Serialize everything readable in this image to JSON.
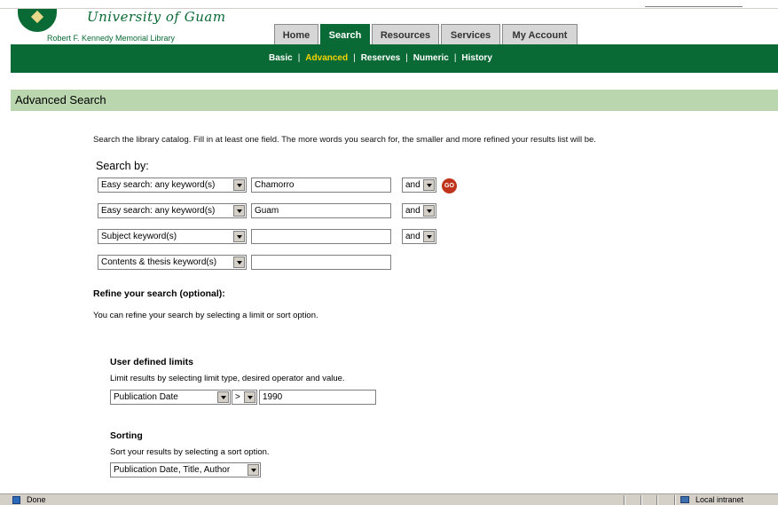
{
  "header": {
    "university": "University of Guam",
    "library": "Robert F. Kennedy Memorial Library",
    "tabs": [
      "Home",
      "Search",
      "Resources",
      "Services",
      "My Account"
    ],
    "active_tab": "Search",
    "subnav": [
      "Basic",
      "Advanced",
      "Reserves",
      "Numeric",
      "History"
    ],
    "active_subnav": "Advanced"
  },
  "page": {
    "title": "Advanced Search",
    "intro": "Search the library catalog. Fill in at least one field. The more words you search for, the smaller and more refined your results list will be.",
    "search_by_label": "Search by:"
  },
  "search_rows": [
    {
      "field": "Easy search: any keyword(s)",
      "value": "Chamorro",
      "operator": "and"
    },
    {
      "field": "Easy search: any keyword(s)",
      "value": "Guam",
      "operator": "and"
    },
    {
      "field": "Subject keyword(s)",
      "value": "",
      "operator": "and"
    },
    {
      "field": "Contents & thesis keyword(s)",
      "value": ""
    }
  ],
  "go_label": "GO",
  "refine": {
    "title": "Refine your search (optional):",
    "note": "You can refine your search by selecting a limit or sort option."
  },
  "limits": {
    "title": "User defined limits",
    "note": "Limit results by selecting limit type, desired operator and value.",
    "type": "Publication Date",
    "operator": ">",
    "value": "1990"
  },
  "sorting": {
    "title": "Sorting",
    "note": "Sort your results by selecting a sort option.",
    "option": "Publication Date, Title, Author"
  },
  "status": {
    "text": "Done",
    "zone": "Local intranet"
  },
  "colors": {
    "brand_green": "#0a6a35",
    "band_green": "#b9d6ae",
    "active_link": "#f5d300",
    "go_button": "#c0341c"
  }
}
